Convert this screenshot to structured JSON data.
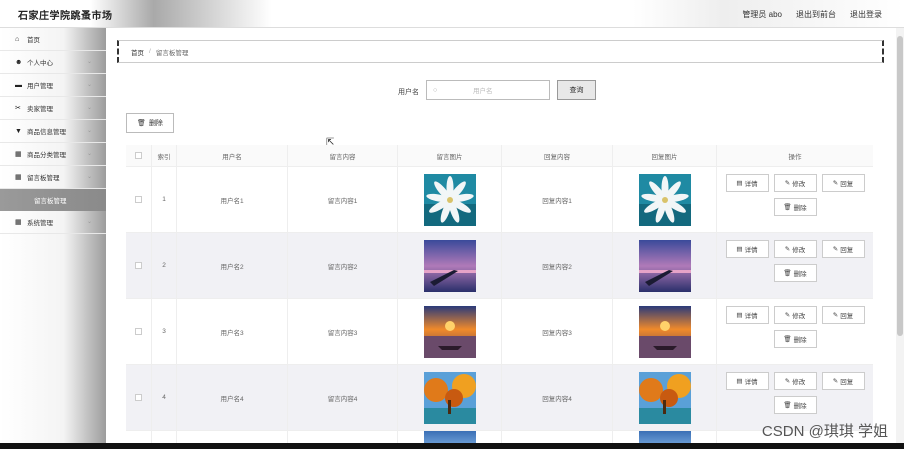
{
  "header": {
    "title": "石家庄学院跳蚤市场",
    "user": "管理员 abo",
    "to_front": "退出到前台",
    "logout": "退出登录"
  },
  "sidebar": {
    "items": [
      {
        "icon": "home-icon",
        "glyph": "⌂",
        "label": "首页",
        "chevron": false
      },
      {
        "icon": "user-icon",
        "glyph": "☻",
        "label": "个人中心",
        "chevron": true
      },
      {
        "icon": "users-icon",
        "glyph": "▬",
        "label": "用户管理",
        "chevron": true
      },
      {
        "icon": "seller-icon",
        "glyph": "✂",
        "label": "卖家管理",
        "chevron": true
      },
      {
        "icon": "goods-icon",
        "glyph": "▼",
        "label": "商品信息管理",
        "chevron": true
      },
      {
        "icon": "category-icon",
        "glyph": "▦",
        "label": "商品分类管理",
        "chevron": true
      },
      {
        "icon": "message-icon",
        "glyph": "▦",
        "label": "留言板管理",
        "chevron": true
      }
    ],
    "active_sub": "留言板管理",
    "system": {
      "icon": "system-icon",
      "glyph": "▦",
      "label": "系统管理"
    }
  },
  "breadcrumb": {
    "home": "首页",
    "current": "留言板管理"
  },
  "search": {
    "label": "用户名",
    "placeholder": "用户名",
    "button": "查询"
  },
  "toolbar": {
    "delete": "删除"
  },
  "table": {
    "headers": [
      "索引",
      "用户名",
      "留言内容",
      "留言图片",
      "回复内容",
      "回复图片",
      "操作"
    ],
    "rows": [
      {
        "index": "1",
        "username": "用户名1",
        "content": "留言内容1",
        "image": "flower",
        "reply": "回复内容1",
        "reply_image": "flower"
      },
      {
        "index": "2",
        "username": "用户名2",
        "content": "留言内容2",
        "image": "dusk",
        "reply": "回复内容2",
        "reply_image": "dusk"
      },
      {
        "index": "3",
        "username": "用户名3",
        "content": "留言内容3",
        "image": "sunset",
        "reply": "回复内容3",
        "reply_image": "sunset"
      },
      {
        "index": "4",
        "username": "用户名4",
        "content": "留言内容4",
        "image": "autumn",
        "reply": "回复内容4",
        "reply_image": "autumn"
      }
    ],
    "ops": {
      "detail": "详情",
      "edit": "修改",
      "reply": "回复",
      "delete": "删除"
    }
  },
  "watermark": "CSDN @琪琪 学姐"
}
